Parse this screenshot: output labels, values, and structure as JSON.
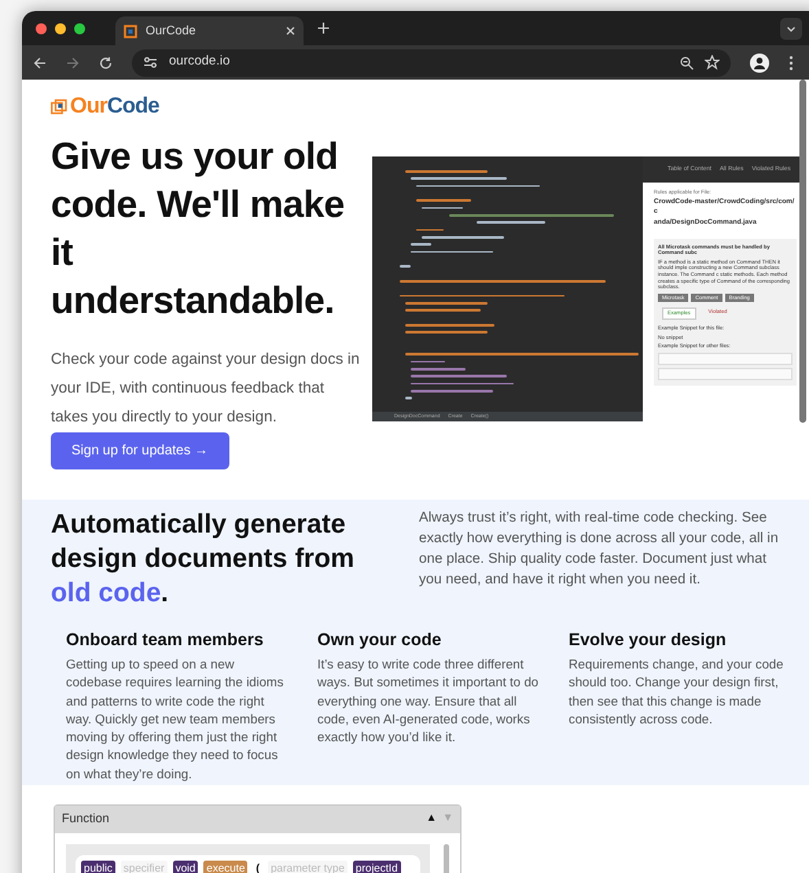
{
  "browser": {
    "tab_title": "OurCode",
    "url": "ourcode.io"
  },
  "logo": {
    "first": "Our",
    "second": "Code"
  },
  "hero": {
    "title": "Give us your old code. We'll make it understandable.",
    "text": "Check your code against your design docs in your IDE, with continuous feedback that takes you directly to your design.",
    "button": "Sign up for updates",
    "button_arrow": "→"
  },
  "ide_screenshot": {
    "nav": [
      "Table of Content",
      "All Rules",
      "Violated Rules"
    ],
    "rules_label": "Rules applicable for File:",
    "file_path": "CrowdCode-master/CrowdCoding/src/com/c",
    "file_path_2": "anda/DesignDocCommand.java",
    "rule_title": "All Microtask commands must be handled by Command subc",
    "rule_text": "IF a method is a static method on Command THEN it should imple constructing a new Command subclass instance. The Command c static methods. Each method creates a specific type of Command of the corresponding subclass.",
    "tags": [
      "Microtask",
      "Comment",
      "Branding"
    ],
    "tabs": [
      {
        "label": "Examples",
        "selected": true
      },
      {
        "label": "Violated",
        "selected": false
      }
    ],
    "snippet_this": "Example Snippet for this file:",
    "no_snippet": "No snippet",
    "snippet_other": "Example Snippet for other files:",
    "footer": [
      "DesignDocCommand",
      "Create",
      "Create()"
    ]
  },
  "features": {
    "heading_before": "Automatically generate design documents from ",
    "heading_highlight": "old code",
    "heading_after": ".",
    "text": "Always trust it’s right, with real-time code checking. See exactly how everything is done across all your code, all in one place. Ship quality code faster. Document just what you need, and have it right when you need it."
  },
  "columns": [
    {
      "title": "Onboard team members",
      "text": "Getting up to speed on a new codebase requires learning the idioms and patterns to write code the right way. Quickly get new team members moving by offering them just the right design knowledge they need to focus on what they’re doing."
    },
    {
      "title": "Own your code",
      "text": "It’s easy to write code three different ways. But sometimes it important to do everything one way. Ensure that all code, even AI-generated code, works exactly how you’d like it."
    },
    {
      "title": "Evolve your design",
      "text": "Requirements change, and your code should too. Change your design first, then see that this change is made consistently across code."
    }
  ],
  "function_widget": {
    "title": "Function",
    "up": "▲",
    "down": "▼",
    "tokens": [
      {
        "text": "public",
        "kind": "keyword"
      },
      {
        "text": "specifier",
        "kind": "placeholder"
      },
      {
        "text": "void",
        "kind": "keyword"
      },
      {
        "text": "execute",
        "kind": "name"
      },
      {
        "text": "(",
        "kind": "plain"
      },
      {
        "text": "parameter type",
        "kind": "placeholder"
      },
      {
        "text": "projectId",
        "kind": "keyword"
      }
    ]
  }
}
